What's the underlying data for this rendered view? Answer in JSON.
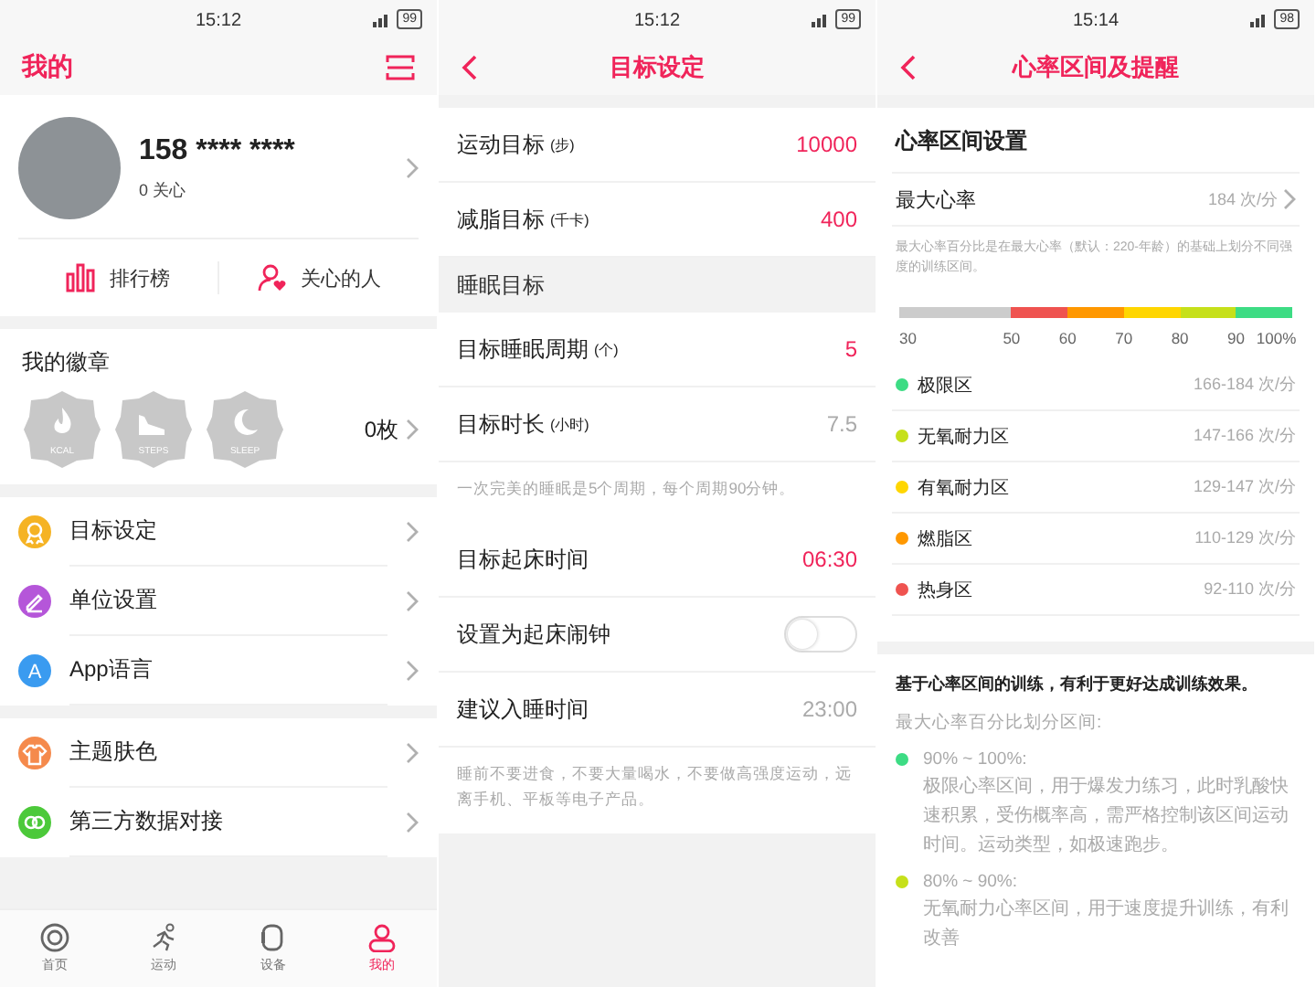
{
  "profile_screen": {
    "status_bar": {
      "time": "15:12",
      "battery": "99"
    },
    "title": "我的",
    "user": {
      "name": "158 **** ****",
      "follow": "0 关心"
    },
    "shortcuts": [
      {
        "label": "排行榜"
      },
      {
        "label": "关心的人"
      }
    ],
    "badges": {
      "title": "我的徽章",
      "count": "0枚",
      "items": [
        {
          "label": "KCAL"
        },
        {
          "label": "STEPS"
        },
        {
          "label": "SLEEP"
        }
      ]
    },
    "menu_groups": [
      [
        {
          "label": "目标设定",
          "color": "#f5b324"
        },
        {
          "label": "单位设置",
          "color": "#b556d9"
        },
        {
          "label": "App语言",
          "icon_text": "A",
          "color": "#3a9bf0"
        }
      ],
      [
        {
          "label": "主题肤色",
          "color": "#f58a4c"
        },
        {
          "label": "第三方数据对接",
          "color": "#4cc93a"
        }
      ]
    ],
    "tab_bar": [
      {
        "label": "首页",
        "selected": false
      },
      {
        "label": "运动",
        "selected": false
      },
      {
        "label": "设备",
        "selected": false
      },
      {
        "label": "我的",
        "selected": true
      }
    ]
  },
  "goal_screen": {
    "status_bar": {
      "time": "15:12",
      "battery": "99"
    },
    "title": "目标设定",
    "groups": [
      {
        "rows": [
          {
            "kind": "value",
            "label": "运动目标",
            "unit": "(步)",
            "value": "10000",
            "editable": true
          },
          {
            "kind": "value",
            "label": "减脂目标",
            "unit": "(千卡)",
            "value": "400",
            "editable": true
          }
        ]
      },
      {
        "heading": "睡眠目标",
        "rows": [
          {
            "kind": "value",
            "label": "目标睡眠周期",
            "unit": "(个)",
            "value": "5",
            "editable": true
          },
          {
            "kind": "value",
            "label": "目标时长",
            "unit": "(小时)",
            "value": "7.5",
            "editable": false
          }
        ],
        "note": "一次完美的睡眠是5个周期，每个周期90分钟。"
      },
      {
        "rows": [
          {
            "kind": "value",
            "label": "目标起床时间",
            "value": "06:30",
            "editable": true
          },
          {
            "kind": "toggle",
            "label": "设置为起床闹钟",
            "on": false
          },
          {
            "kind": "value",
            "label": "建议入睡时间",
            "value": "23:00",
            "editable": false
          }
        ],
        "note": "睡前不要进食，不要大量喝水，不要做高强度运动，远离手机、平板等电子产品。"
      }
    ]
  },
  "heart_rate_screen": {
    "status_bar": {
      "time": "15:14",
      "battery": "98"
    },
    "title": "心率区间及提醒",
    "zone_settings": {
      "title": "心率区间设置",
      "max_heart_rate": {
        "label": "最大心率",
        "value": "184 次/分"
      },
      "note": "最大心率百分比是在最大心率（默认：220-年龄）的基础上划分不同强度的训练区间。",
      "scale": {
        "ticks": [
          "30",
          "50",
          "60",
          "70",
          "80",
          "90",
          "100%"
        ],
        "segments": [
          {
            "color": "#cccccc"
          },
          {
            "color": "#ef5350"
          },
          {
            "color": "#ff9800"
          },
          {
            "color": "#ffd600"
          },
          {
            "color": "#c6e01a"
          },
          {
            "color": "#3ddc84"
          }
        ]
      },
      "zones": [
        {
          "name": "极限区",
          "range": "166-184 次/分",
          "color": "#3ddc84"
        },
        {
          "name": "无氧耐力区",
          "range": "147-166 次/分",
          "color": "#c6e01a"
        },
        {
          "name": "有氧耐力区",
          "range": "129-147 次/分",
          "color": "#ffd600"
        },
        {
          "name": "燃脂区",
          "range": "110-129 次/分",
          "color": "#ff9800"
        },
        {
          "name": "热身区",
          "range": "92-110 次/分",
          "color": "#ef5350"
        }
      ]
    },
    "guide": {
      "heading": "基于心率区间的训练，有利于更好达成训练效果。",
      "subheading": "最大心率百分比划分区间:",
      "items": [
        {
          "range": "90% ~ 100%:",
          "color": "#3ddc84",
          "description": "极限心率区间，用于爆发力练习，此时乳酸快速积累，受伤概率高，需严格控制该区间运动时间。运动类型，如极速跑步。"
        },
        {
          "range": "80% ~ 90%:",
          "color": "#c6e01a",
          "description": "无氧耐力心率区间，用于速度提升训练，有利改善"
        }
      ]
    }
  }
}
